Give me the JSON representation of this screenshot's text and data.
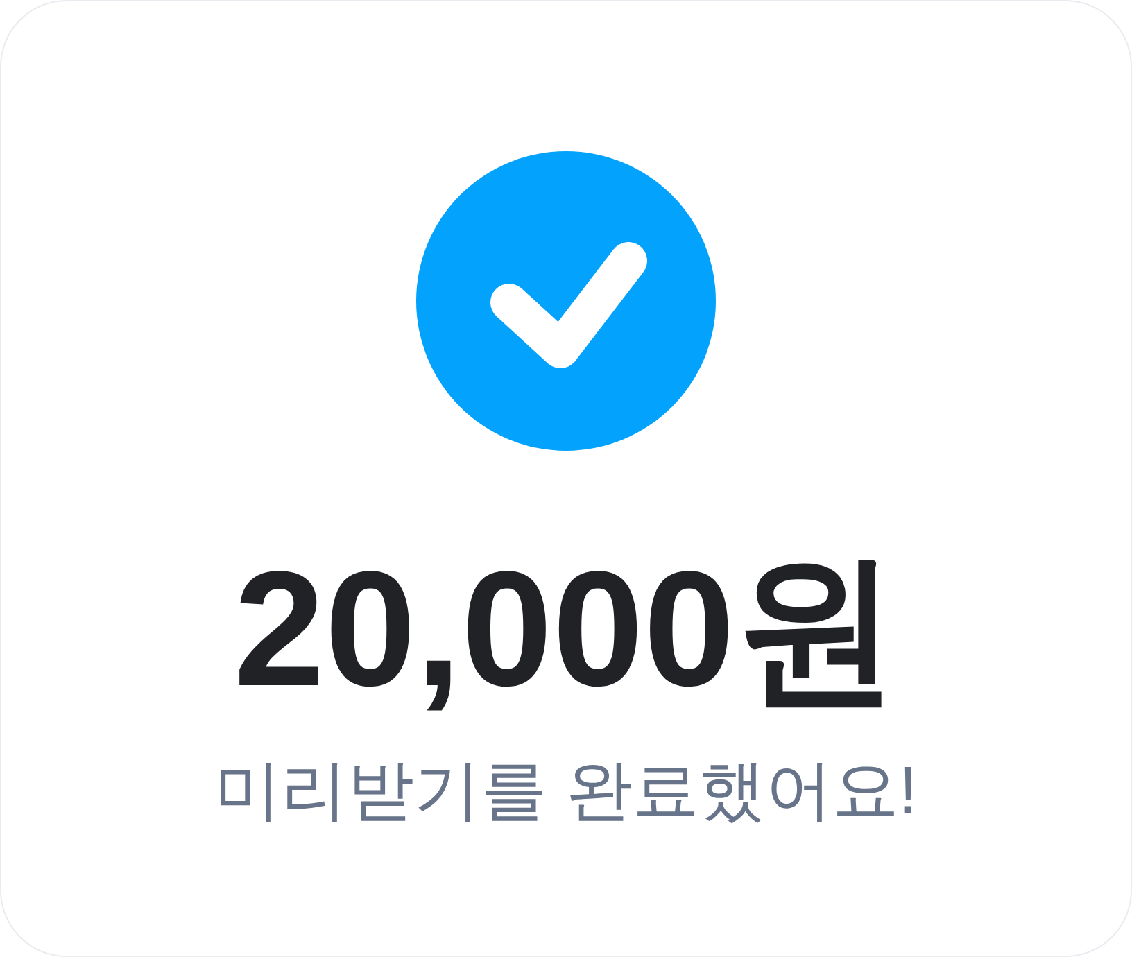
{
  "amount": "20,000원",
  "message": "미리받기를 완료했어요!"
}
